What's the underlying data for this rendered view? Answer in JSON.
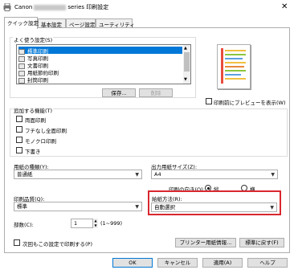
{
  "window": {
    "title_prefix": "Canon",
    "title_suffix": "series 印刷設定",
    "close_glyph": "✕"
  },
  "tabs": [
    {
      "label": "クイック設定"
    },
    {
      "label": "基本設定"
    },
    {
      "label": "ページ設定"
    },
    {
      "label": "ユーティリティ"
    }
  ],
  "favorites": {
    "label": "よく使う設定(S)",
    "items": [
      "標準印刷",
      "写真印刷",
      "文書印刷",
      "用紙節約印刷",
      "封筒印刷"
    ],
    "selected_index": 0,
    "save_button": "保存...",
    "delete_button": "削除"
  },
  "preview": {
    "checkbox_label": "印刷前にプレビューを表示(W)"
  },
  "additional": {
    "label": "追加する機能(T)",
    "items": [
      "両面印刷",
      "フチなし全面印刷",
      "モノクロ印刷",
      "下書き"
    ]
  },
  "media_type": {
    "label": "用紙の種類(Y):",
    "value": "普通紙"
  },
  "paper_size": {
    "label": "出力用紙サイズ(Z):",
    "value": "A4"
  },
  "orientation": {
    "label": "印刷の向き(O):",
    "portrait": "縦",
    "landscape": "横",
    "selected": "portrait"
  },
  "quality": {
    "label": "印刷品質(Q):",
    "value": "標準"
  },
  "paper_source": {
    "label": "給紙方法(R):",
    "value": "自動選択"
  },
  "copies": {
    "label": "部数(C):",
    "value": "1",
    "range": "(1~999)"
  },
  "always_print": {
    "label": "次回もこの設定で印刷する(P)"
  },
  "printer_media_info_button": "プリンター用紙情報...",
  "defaults_button": "標準に戻す(F)",
  "footer": {
    "ok": "OK",
    "cancel": "キャンセル",
    "apply": "適用(A)",
    "help": "ヘルプ"
  },
  "colors": {
    "selection": "#0078d7",
    "highlight": "#d9272e"
  }
}
